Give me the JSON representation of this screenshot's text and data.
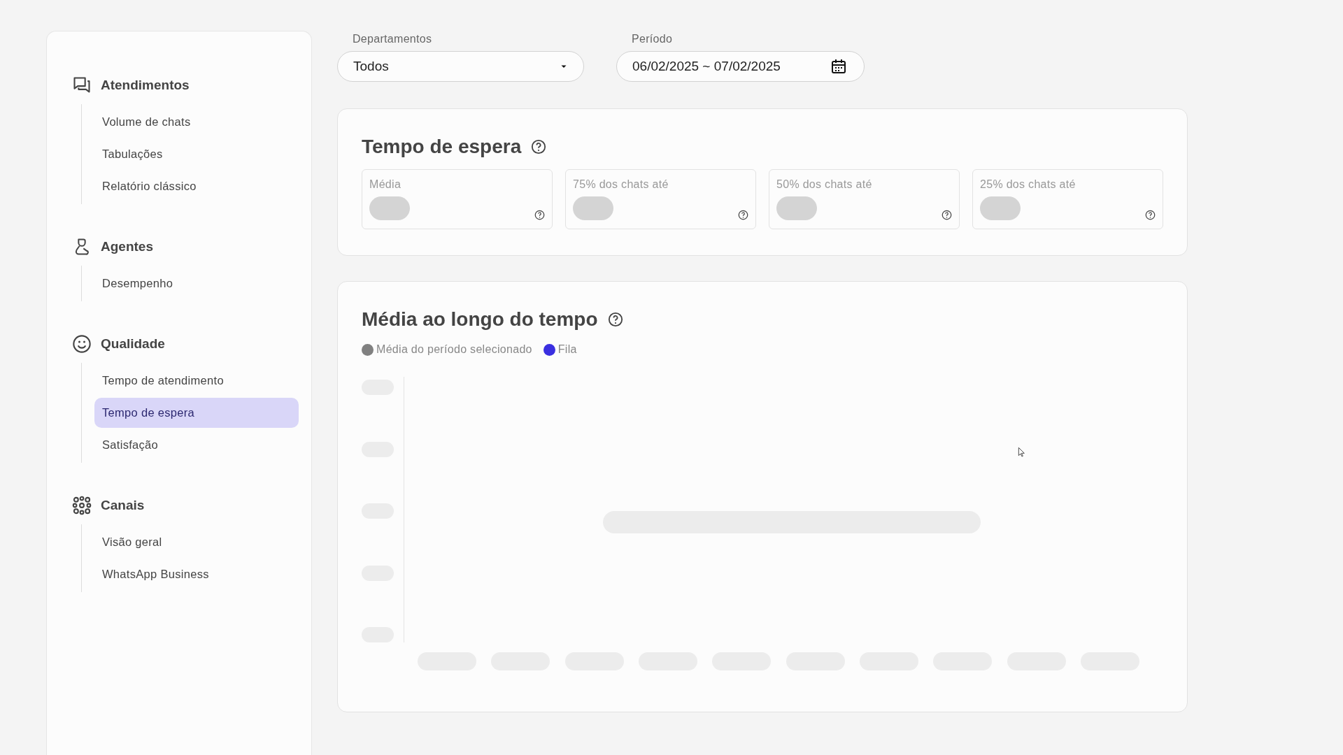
{
  "sidebar": {
    "sections": [
      {
        "kind": "chats",
        "title": "Atendimentos",
        "items": [
          {
            "label": "Volume de chats",
            "selected": false
          },
          {
            "label": "Tabulações",
            "selected": false
          },
          {
            "label": "Relatório clássico",
            "selected": false
          }
        ]
      },
      {
        "kind": "agents",
        "title": "Agentes",
        "items": [
          {
            "label": "Desempenho",
            "selected": false
          }
        ]
      },
      {
        "kind": "quality",
        "title": "Qualidade",
        "items": [
          {
            "label": "Tempo de atendimento",
            "selected": false
          },
          {
            "label": "Tempo de espera",
            "selected": true
          },
          {
            "label": "Satisfação",
            "selected": false
          }
        ]
      },
      {
        "kind": "channels",
        "title": "Canais",
        "items": [
          {
            "label": "Visão geral",
            "selected": false
          },
          {
            "label": "WhatsApp Business",
            "selected": false
          }
        ]
      }
    ]
  },
  "filters": [
    {
      "kind": "select",
      "label": "Departamentos",
      "value": "Todos"
    },
    {
      "kind": "date",
      "label": "Período",
      "value": "06/02/2025 ~ 07/02/2025"
    }
  ],
  "wait_card": {
    "title": "Tempo de espera",
    "stats": [
      {
        "label": "Média"
      },
      {
        "label": "75% dos chats até"
      },
      {
        "label": "50% dos chats até"
      },
      {
        "label": "25% dos chats até"
      }
    ]
  },
  "chart_card": {
    "title": "Média ao longo do tempo",
    "legend": [
      {
        "label": "Média do período selecionado",
        "color": "#808080"
      },
      {
        "label": "Fila",
        "color": "#3a2fe0"
      }
    ]
  }
}
